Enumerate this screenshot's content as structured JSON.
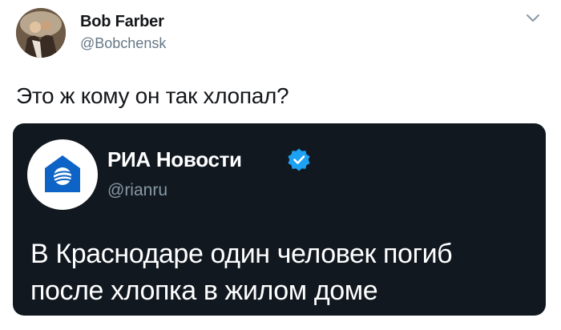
{
  "tweet": {
    "author_name": "Bob Farber",
    "author_handle": "@Bobchensk",
    "text": "Это ж кому он так хлопал?"
  },
  "quoted_tweet": {
    "author_name": "РИА Новости",
    "author_handle": "@rianru",
    "verified": true,
    "text_line1": "В Краснодаре один человек погиб",
    "text_line2": "после хлопка в жилом доме"
  },
  "icons": {
    "menu": "chevron-down-icon",
    "verified": "verified-badge-icon",
    "quoted_avatar": "ria-logo-icon"
  },
  "colors": {
    "quote_background": "#111820",
    "verified_blue": "#1da1f2",
    "logo_blue": "#0e63c6",
    "secondary_text": "#657786"
  }
}
